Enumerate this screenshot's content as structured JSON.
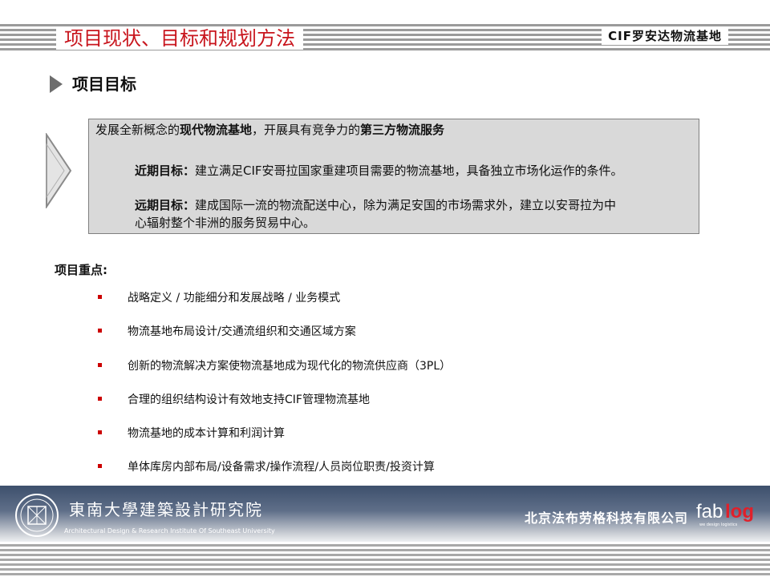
{
  "header": {
    "title": "项目现状、目标和规划方法",
    "brand": "CIF罗安达物流基地"
  },
  "section": {
    "title": "项目目标"
  },
  "goals": {
    "main_prefix": "发展全新概念的",
    "main_bold1": "现代物流基地",
    "main_mid": "，开展具有竞争力的",
    "main_bold2": "第三方物流服务",
    "near_label": "近期目标：",
    "near_text": "建立满足CIF安哥拉国家重建项目需要的物流基地，具备独立市场化运作的条件。",
    "far_label": "远期目标：",
    "far_text_line1": "建成国际一流的物流配送中心，除为满足安国的市场需求外，建立以安哥拉为中",
    "far_text_line2": "心辐射整个非洲的服务贸易中心。"
  },
  "key_points": {
    "label": "项目重点:",
    "items": [
      "战略定义 / 功能细分和发展战略 / 业务模式",
      "物流基地布局设计/交通流组织和交通区域方案",
      "创新的物流解决方案使物流基地成为现代化的物流供应商（3PL）",
      "合理的组织结构设计有效地支持CIF管理物流基地",
      "物流基地的成本计算和利润计算",
      "单体库房内部布局/设备需求/操作流程/人员岗位职责/投资计算"
    ]
  },
  "footer": {
    "university_cn": "東南大學建築設計研究院",
    "university_en": "Architectural Design & Research Institute Of Southeast University",
    "company_cn": "北京法布劳格科技有限公司",
    "logo_text_a": "fab",
    "logo_text_b": "log",
    "logo_tagline": "we design logistics"
  },
  "colors": {
    "title_red": "#c8141c",
    "bullet_red": "#cc0000",
    "footer_blue": "#3d4f6c",
    "box_gray": "#d9d9d9",
    "logo_red": "#e0202a"
  }
}
